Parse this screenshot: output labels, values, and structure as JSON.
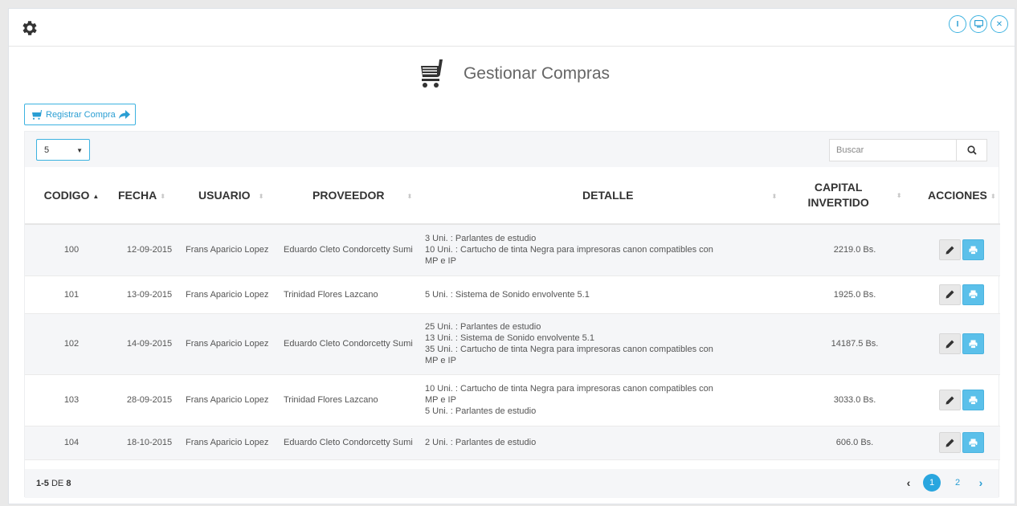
{
  "header": {
    "title": "Gestionar Compras",
    "register_button": "Registrar Compra"
  },
  "window_buttons": [
    "info-icon",
    "monitor-icon",
    "close-icon"
  ],
  "toolbar": {
    "page_size": "5",
    "search_placeholder": "Buscar"
  },
  "table": {
    "columns": [
      "CODIGO",
      "FECHA",
      "USUARIO",
      "PROVEEDOR",
      "DETALLE",
      "CAPITAL INVERTIDO",
      "ACCIONES"
    ],
    "rows": [
      {
        "codigo": "100",
        "fecha": "12-09-2015",
        "usuario": "Frans Aparicio Lopez",
        "proveedor": "Eduardo Cleto Condorcetty Sumi",
        "detalle": [
          "3 Uni. : Parlantes de estudio",
          "10 Uni. : Cartucho de tinta Negra para impresoras canon compatibles con",
          "MP e IP"
        ],
        "capital": "2219.0 Bs."
      },
      {
        "codigo": "101",
        "fecha": "13-09-2015",
        "usuario": "Frans Aparicio Lopez",
        "proveedor": "Trinidad Flores Lazcano",
        "detalle": [
          "5 Uni. : Sistema de Sonido envolvente 5.1"
        ],
        "capital": "1925.0 Bs."
      },
      {
        "codigo": "102",
        "fecha": "14-09-2015",
        "usuario": "Frans Aparicio Lopez",
        "proveedor": "Eduardo Cleto Condorcetty Sumi",
        "detalle": [
          "25 Uni. : Parlantes de estudio",
          "13 Uni. : Sistema de Sonido envolvente 5.1",
          "35 Uni. : Cartucho de tinta Negra para impresoras canon compatibles con",
          "MP e IP"
        ],
        "capital": "14187.5 Bs."
      },
      {
        "codigo": "103",
        "fecha": "28-09-2015",
        "usuario": "Frans Aparicio Lopez",
        "proveedor": "Trinidad Flores Lazcano",
        "detalle": [
          "10 Uni. : Cartucho de tinta Negra para impresoras canon compatibles con",
          "MP e IP",
          "5 Uni. : Parlantes de estudio"
        ],
        "capital": "3033.0 Bs."
      },
      {
        "codigo": "104",
        "fecha": "18-10-2015",
        "usuario": "Frans Aparicio Lopez",
        "proveedor": "Eduardo Cleto Condorcetty Sumi",
        "detalle": [
          "2 Uni. : Parlantes de estudio"
        ],
        "capital": "606.0 Bs."
      }
    ]
  },
  "footer": {
    "range": "1-5",
    "of_label": "DE",
    "total": "8",
    "pages": [
      "1",
      "2"
    ],
    "current_page": "1"
  },
  "colors": {
    "accent": "#29a6df",
    "print_button": "#5bc0ea"
  }
}
